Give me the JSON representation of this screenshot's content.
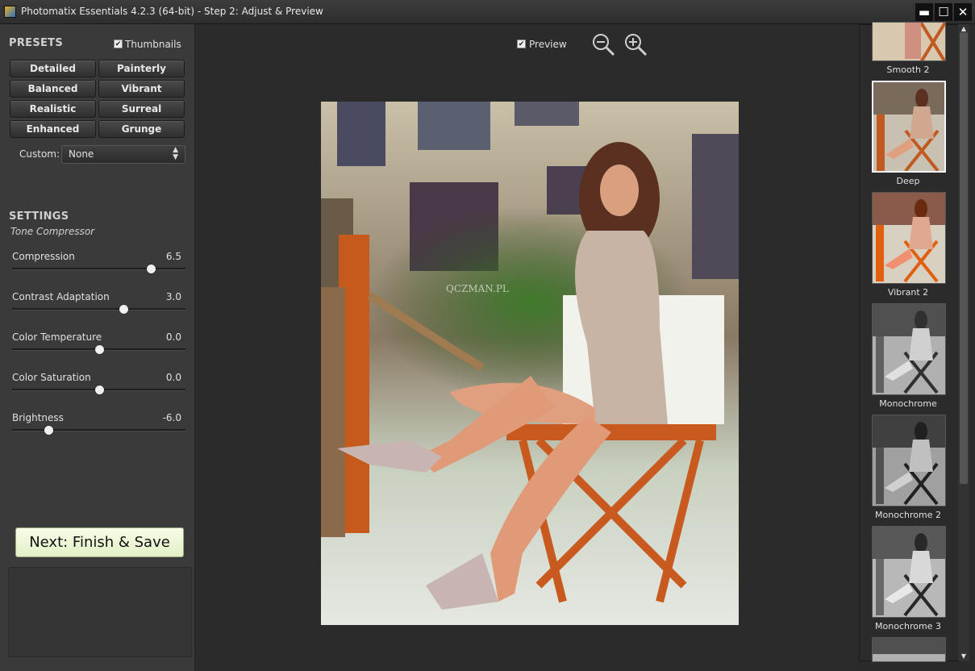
{
  "window": {
    "title": "Photomatix Essentials 4.2.3 (64-bit) - Step 2: Adjust & Preview",
    "minimize": "▬",
    "maximize": "☐",
    "close": "✕"
  },
  "presets": {
    "title": "PRESETS",
    "thumbnails_label": "Thumbnails",
    "thumbnails_checked": true,
    "buttons": [
      "Detailed",
      "Painterly",
      "Balanced",
      "Vibrant",
      "Realistic",
      "Surreal",
      "Enhanced",
      "Grunge"
    ],
    "custom_label": "Custom:",
    "custom_value": "None"
  },
  "settings": {
    "title": "SETTINGS",
    "method": "Tone Compressor",
    "sliders": [
      {
        "label": "Compression",
        "value": "6.5",
        "fraction": 0.8
      },
      {
        "label": "Contrast Adaptation",
        "value": "3.0",
        "fraction": 0.64
      },
      {
        "label": "Color Temperature",
        "value": "0.0",
        "fraction": 0.5
      },
      {
        "label": "Color Saturation",
        "value": "0.0",
        "fraction": 0.5
      },
      {
        "label": "Brightness",
        "value": "-6.0",
        "fraction": 0.21
      }
    ]
  },
  "next_button": "Next: Finish & Save",
  "preview": {
    "label": "Preview",
    "checked": true,
    "zoom_out_icon": "zoom-out-icon",
    "zoom_in_icon": "zoom-in-icon",
    "watermark": "QCZMAN.PL"
  },
  "thumbnails": [
    {
      "label": "Smooth 2",
      "style": "color"
    },
    {
      "label": "Deep",
      "style": "color",
      "selected": true
    },
    {
      "label": "Vibrant 2",
      "style": "vivid"
    },
    {
      "label": "Monochrome",
      "style": "mono"
    },
    {
      "label": "Monochrome 2",
      "style": "mono"
    },
    {
      "label": "Monochrome 3",
      "style": "mono"
    }
  ],
  "colors": {
    "panel": "#3a3a3a",
    "background": "#2b2b2b",
    "next_button": "#eef6d8"
  }
}
